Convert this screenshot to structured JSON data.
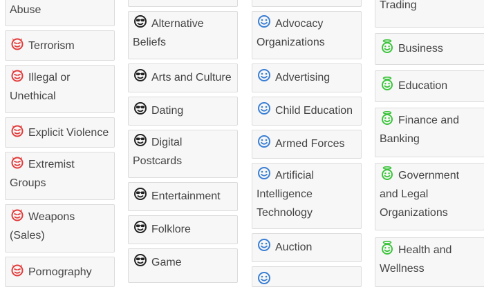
{
  "columns": [
    {
      "rating": "block",
      "items": [
        {
          "label": "Abuse",
          "icon": "devil-face-icon"
        },
        {
          "label": "Terrorism",
          "icon": "devil-face-icon"
        },
        {
          "label": "Illegal or Unethical",
          "icon": "devil-face-icon"
        },
        {
          "label": "Explicit Violence",
          "icon": "devil-face-icon"
        },
        {
          "label": "Extremist Groups",
          "icon": "devil-face-icon"
        },
        {
          "label": "Weapons (Sales)",
          "icon": "devil-face-icon"
        },
        {
          "label": "Pornography",
          "icon": "devil-face-icon"
        }
      ]
    },
    {
      "rating": "caution",
      "items": [
        {
          "label": "Alternative Beliefs",
          "icon": "sunglasses-face-icon"
        },
        {
          "label": "Arts and Culture",
          "icon": "sunglasses-face-icon"
        },
        {
          "label": "Dating",
          "icon": "sunglasses-face-icon"
        },
        {
          "label": "Digital Postcards",
          "icon": "sunglasses-face-icon"
        },
        {
          "label": "Entertainment",
          "icon": "sunglasses-face-icon"
        },
        {
          "label": "Folklore",
          "icon": "sunglasses-face-icon"
        },
        {
          "label": "Game",
          "icon": "sunglasses-face-icon"
        }
      ]
    },
    {
      "rating": "neutral",
      "items": [
        {
          "label": "Advocacy Organizations",
          "icon": "smiley-face-icon"
        },
        {
          "label": "Advertising",
          "icon": "smiley-face-icon"
        },
        {
          "label": "Child Education",
          "icon": "smiley-face-icon"
        },
        {
          "label": "Armed Forces",
          "icon": "smiley-face-icon"
        },
        {
          "label": "Artificial Intelligence Technology",
          "icon": "smiley-face-icon"
        },
        {
          "label": "Auction",
          "icon": "smiley-face-icon"
        }
      ]
    },
    {
      "rating": "safe",
      "items": [
        {
          "label": "Trading",
          "icon": "angel-face-icon"
        },
        {
          "label": "Business",
          "icon": "angel-face-icon"
        },
        {
          "label": "Education",
          "icon": "angel-face-icon"
        },
        {
          "label": "Finance and Banking",
          "icon": "angel-face-icon"
        },
        {
          "label": "Government and Legal Organizations",
          "icon": "angel-face-icon"
        },
        {
          "label": "Health and Wellness",
          "icon": "angel-face-icon"
        }
      ]
    }
  ],
  "colors": {
    "devil": "#e23b3b",
    "sunglasses": "#222222",
    "smiley": "#3a7fd5",
    "angel": "#3cc43c",
    "tile_bg": "#f7f7f7",
    "tile_border": "#dcdcdc",
    "text": "#444444"
  }
}
